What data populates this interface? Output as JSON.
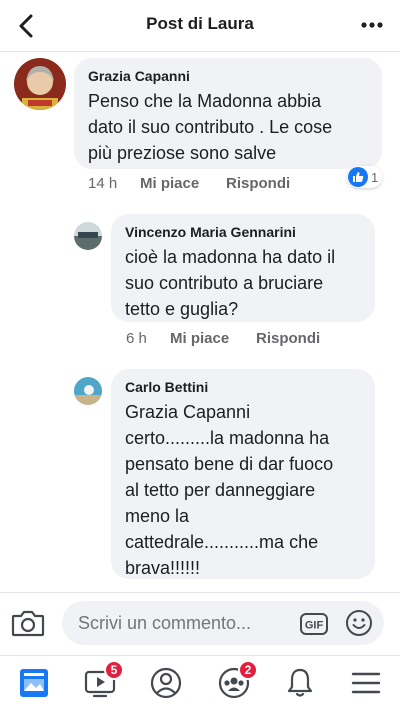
{
  "header": {
    "title": "Post di Laura",
    "back_icon": "chevron-left-icon",
    "more_icon": "more-horizontal-icon"
  },
  "comments": [
    {
      "author": "Grazia Capanni",
      "text": "Penso che la Madonna abbia\ndato il suo contributo . Le cose\npiù preziose sono salve",
      "time": "14 h",
      "like_label": "Mi piace",
      "reply_label": "Rispondi",
      "reaction_count": "1"
    },
    {
      "author": "Vincenzo Maria Gennarini",
      "text": "cioè la madonna ha dato il\nsuo contributo a bruciare\ntetto e guglia?",
      "time": "6 h",
      "like_label": "Mi piace",
      "reply_label": "Rispondi"
    },
    {
      "author": "Carlo Bettini",
      "text": "Grazia Capanni\ncerto.........la madonna ha\npensato bene di dar fuoco\nal tetto per danneggiare\nmeno la\ncattedrale...........ma che\nbrava!!!!!!"
    }
  ],
  "composer": {
    "placeholder": "Scrivi un commento...",
    "gif_label": "GIF"
  },
  "tabbar": {
    "video_badge": "5",
    "groups_badge": "2"
  },
  "colors": {
    "accent": "#1877f2",
    "badge": "#e41e3f",
    "bubble": "#f0f2f5",
    "secondary_text": "#65676b"
  }
}
